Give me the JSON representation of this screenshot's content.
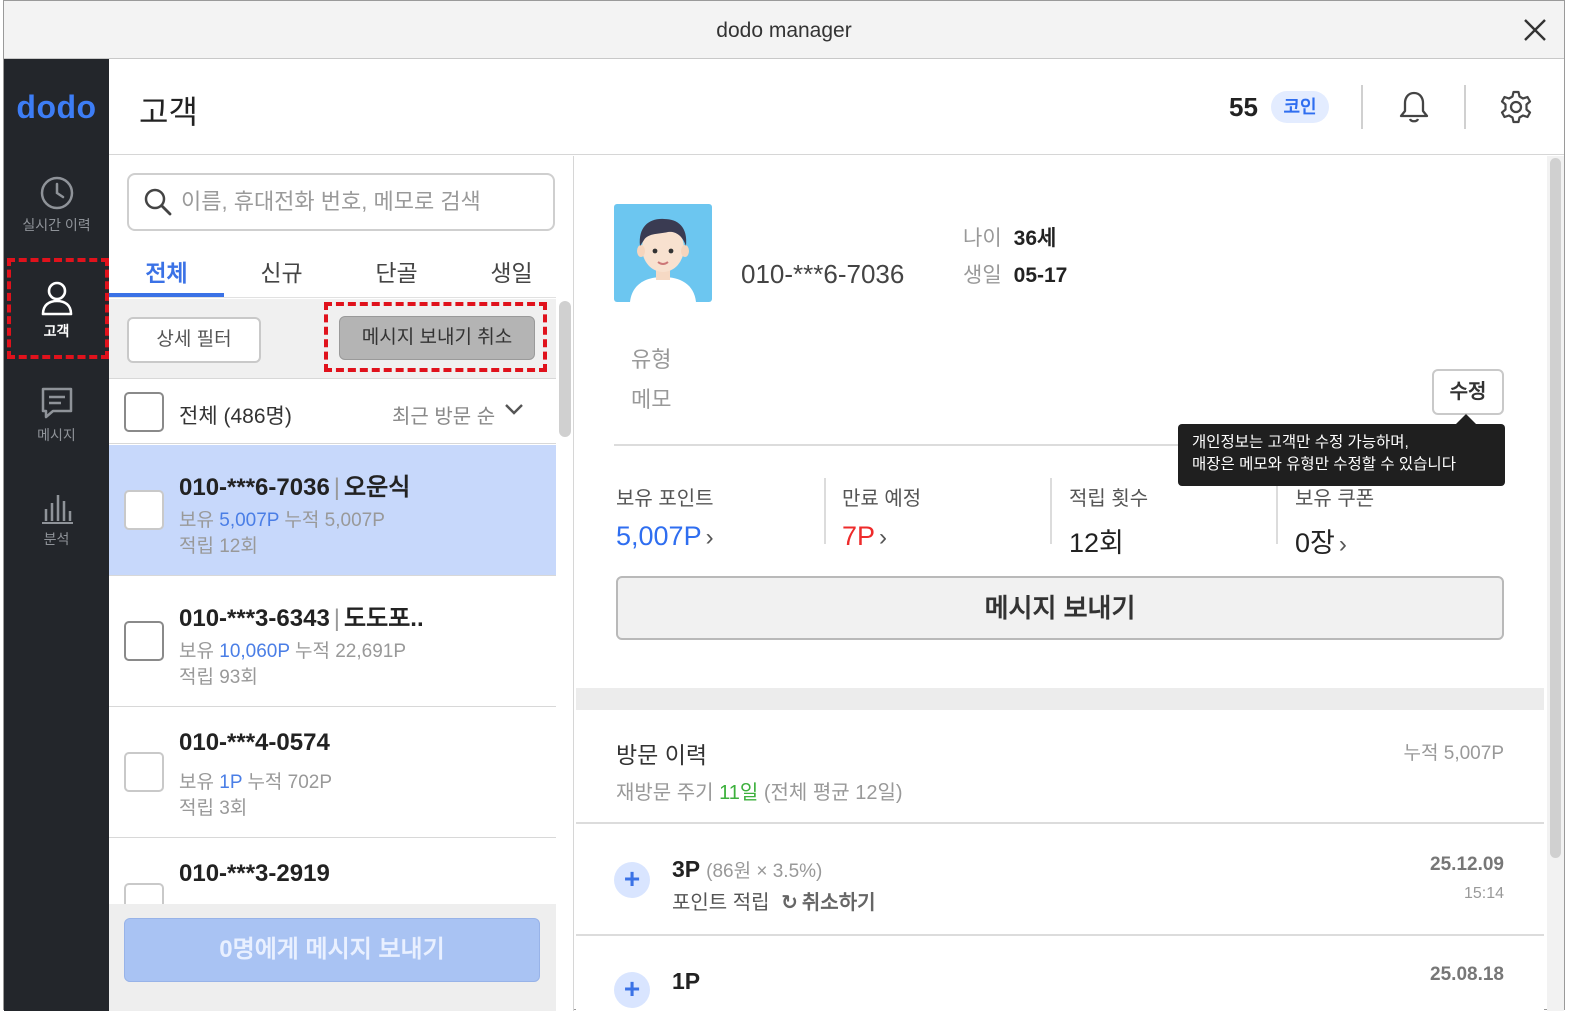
{
  "window": {
    "title": "dodo manager"
  },
  "sidebar": {
    "logo": "dodo",
    "items": [
      {
        "label": "실시간 이력",
        "icon": "clock-icon"
      },
      {
        "label": "고객",
        "icon": "person-icon"
      },
      {
        "label": "메시지",
        "icon": "chat-icon"
      },
      {
        "label": "분석",
        "icon": "bar-chart-icon"
      }
    ]
  },
  "header": {
    "title": "고객",
    "coin_count": "55",
    "coin_label": "코인"
  },
  "left": {
    "search_placeholder": "이름, 휴대전화 번호, 메모로 검색",
    "tabs": [
      "전체",
      "신규",
      "단골",
      "생일"
    ],
    "filter_button": "상세 필터",
    "cancel_button": "메시지 보내기 취소",
    "list_header": {
      "all_label": "전체 (486명)",
      "sort_label": "최근 방문 순"
    },
    "customers": [
      {
        "phone": "010-***6-7036",
        "name": "오운식",
        "hold_label": "보유",
        "hold": "5,007P",
        "total": "누적 5,007P",
        "count": "적립 12회"
      },
      {
        "phone": "010-***3-6343",
        "name": "도도포..",
        "hold_label": "보유",
        "hold": "10,060P",
        "total": "누적 22,691P",
        "count": "적립 93회"
      },
      {
        "phone": "010-***4-0574",
        "name": "",
        "hold_label": "보유",
        "hold": "1P",
        "total": "누적 702P",
        "count": "적립 3회"
      },
      {
        "phone": "010-***3-2919",
        "name": "",
        "hold_label": "",
        "hold": "",
        "total": "",
        "count": ""
      }
    ],
    "send_bulk_button": "0명에게 메시지 보내기"
  },
  "detail": {
    "phone": "010-***6-7036",
    "age_label": "나이",
    "age": "36세",
    "birthday_label": "생일",
    "birthday": "05-17",
    "type_label": "유형",
    "memo_label": "메모",
    "edit_button": "수정",
    "tooltip_line1": "개인정보는 고객만 수정 가능하며,",
    "tooltip_line2": "매장은 메모와 유형만 수정할 수 있습니다",
    "stats": [
      {
        "label": "보유 포인트",
        "value": "5,007P",
        "color": "#2f6ef0"
      },
      {
        "label": "만료 예정",
        "value": "7P",
        "color": "#ee2b2b"
      },
      {
        "label": "적립 횟수",
        "value": "12회",
        "color": "#222222"
      },
      {
        "label": "보유 쿠폰",
        "value": "0장",
        "color": "#222222"
      }
    ],
    "send_button": "메시지 보내기",
    "visit": {
      "title": "방문 이력",
      "total": "누적 5,007P",
      "sub_prefix": "재방문 주기",
      "sub_days": "11일",
      "sub_suffix": "(전체 평균 12일)"
    },
    "history": [
      {
        "points": "3P",
        "detail": "(86원 × 3.5%)",
        "desc": "포인트 적립",
        "undo": "취소하기",
        "date": "25.12.09",
        "time": "15:14"
      },
      {
        "points": "1P",
        "detail": "",
        "desc": "",
        "undo": "",
        "date": "25.08.18",
        "time": ""
      }
    ]
  }
}
